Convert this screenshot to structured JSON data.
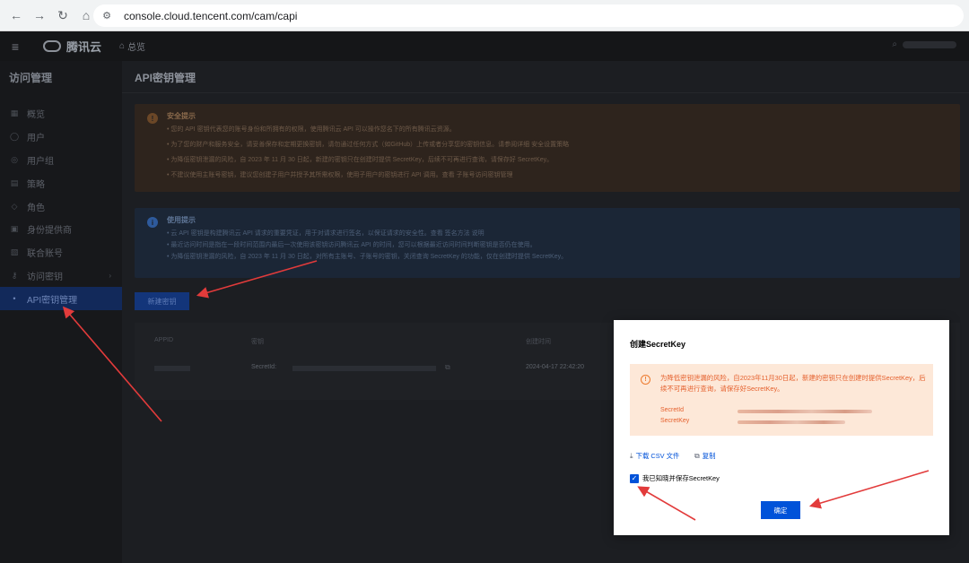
{
  "browser": {
    "url": "console.cloud.tencent.com/cam/capi"
  },
  "console_top": {
    "brand": "腾讯云",
    "home": "总览"
  },
  "sidebar": {
    "title": "访问管理",
    "items": [
      {
        "label": "概览",
        "icon": "overview-icon",
        "glyph": "▦"
      },
      {
        "label": "用户",
        "icon": "user-icon",
        "glyph": "◯"
      },
      {
        "label": "用户组",
        "icon": "user-group-icon",
        "glyph": "◎"
      },
      {
        "label": "策略",
        "icon": "policy-icon",
        "glyph": "▤"
      },
      {
        "label": "角色",
        "icon": "role-icon",
        "glyph": "◇"
      },
      {
        "label": "身份提供商",
        "icon": "identity-provider-icon",
        "glyph": "▣"
      },
      {
        "label": "联合账号",
        "icon": "federated-account-icon",
        "glyph": "▧"
      },
      {
        "label": "访问密钥",
        "icon": "access-key-icon",
        "glyph": "⚷"
      },
      {
        "label": "API密钥管理",
        "icon": "api-key-icon",
        "glyph": "•",
        "active": true
      }
    ]
  },
  "main": {
    "title": "API密钥管理",
    "warning": {
      "title": "安全提示",
      "lines": [
        "• 您的 API 密钥代表您的账号身份和所拥有的权限，使用腾讯云 API 可以操作您名下的所有腾讯云资源。",
        "• 为了您的财产和服务安全，请妥善保存和定期更换密钥，请勿通过任何方式（如GitHub）上传或者分享您的密钥信息。请参阅详细 安全设置策略",
        "• 为降低密钥泄漏的风险，自 2023 年 11 月 30 日起，新建的密钥只在创建时提供 SecretKey，后续不可再进行查询，请保存好 SecretKey。",
        "• 不建议使用主账号密钥，建议您创建子用户并授予其所需权限，使用子用户的密钥进行 API 调用。查看 子账号访问密钥管理"
      ]
    },
    "info": {
      "title": "使用提示",
      "lines": [
        "• 云 API 密钥是构建腾讯云 API 请求的重要凭证，用于对请求进行签名，以保证请求的安全性。查看 签名方法 说明",
        "• 最近访问时间是指在一段时间范围内最后一次使用该密钥访问腾讯云 API 的时间，您可以根据最近访问时间判断密钥是否仍在使用。",
        "• 为降低密钥泄漏的风险，自 2023 年 11 月 30 日起，对所有主账号、子账号的密钥，关闭查询 SecretKey 的功能，仅在创建时提供 SecretKey。"
      ]
    },
    "create_button": "新建密钥",
    "table": {
      "columns": [
        "APPID",
        "密钥",
        "创建时间"
      ],
      "row": {
        "secret_label": "SecretId:",
        "created": "2024-04-17 22:42:20"
      }
    }
  },
  "modal": {
    "title": "创建SecretKey",
    "alert": "为降低密钥泄漏的风险，自2023年11月30日起，新建的密钥只在创建时提供SecretKey，后续不可再进行查询，请保存好SecretKey。",
    "secret_id_label": "SecretId",
    "secret_key_label": "SecretKey",
    "download_label": "下载 CSV 文件",
    "copy_label": "复制",
    "ack_label": "我已知晓并保存SecretKey",
    "ack_checked": true,
    "confirm_label": "确定"
  },
  "colors": {
    "accent": "#0052d9",
    "annotation_arrow": "#e23b3b",
    "alert_bg": "#fde8d8",
    "alert_text": "#e5602d"
  }
}
